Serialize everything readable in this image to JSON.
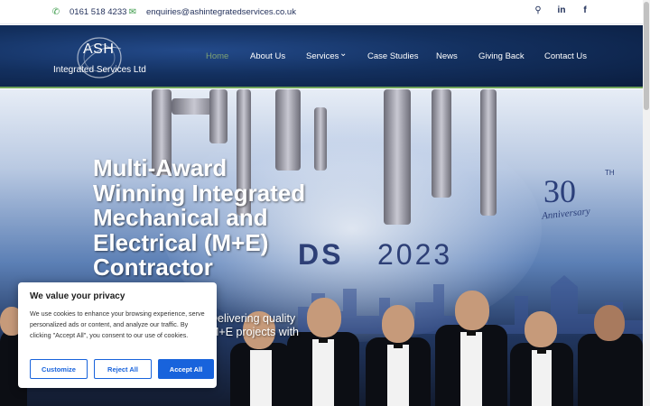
{
  "topbar": {
    "phone": "0161 518 4233",
    "email": "enquiries@ashintegratedservices.co.uk",
    "phone_icon": "phone-icon",
    "email_icon": "envelope-icon",
    "icons": [
      "search-icon",
      "linkedin-icon",
      "facebook-icon"
    ]
  },
  "brand": {
    "logo_line1": "ASH",
    "logo_line2": "Integrated Services Ltd"
  },
  "nav": {
    "items": [
      {
        "label": "Home",
        "active": true
      },
      {
        "label": "About Us"
      },
      {
        "label": "Services"
      },
      {
        "label": "Case Studies"
      },
      {
        "label": "News"
      },
      {
        "label": "Giving Back"
      },
      {
        "label": "Contact Us"
      }
    ],
    "services_caret": "⌄"
  },
  "hero": {
    "headline": "Multi-Award Winning Integrated Mechanical and Electrical (M+E) Contractor",
    "subline": "Delivering quality M+E projects with project management and",
    "backdrop_text_1": "DS",
    "backdrop_text_2": "2023",
    "anniversary_number": "30",
    "anniversary_suffix": "TH",
    "anniversary_label": "Anniversary"
  },
  "cookie": {
    "title": "We value your privacy",
    "description": "We use cookies to enhance your browsing experience, serve personalized ads or content, and analyze our traffic. By clicking \"Accept All\", you consent to our use of cookies.",
    "customize": "Customize",
    "reject": "Reject All",
    "accept": "Accept All"
  },
  "colors": {
    "accent_green": "#3c9b4a",
    "nav_active": "#7ea274",
    "navy": "#13305f",
    "cookie_blue": "#1863dc"
  }
}
